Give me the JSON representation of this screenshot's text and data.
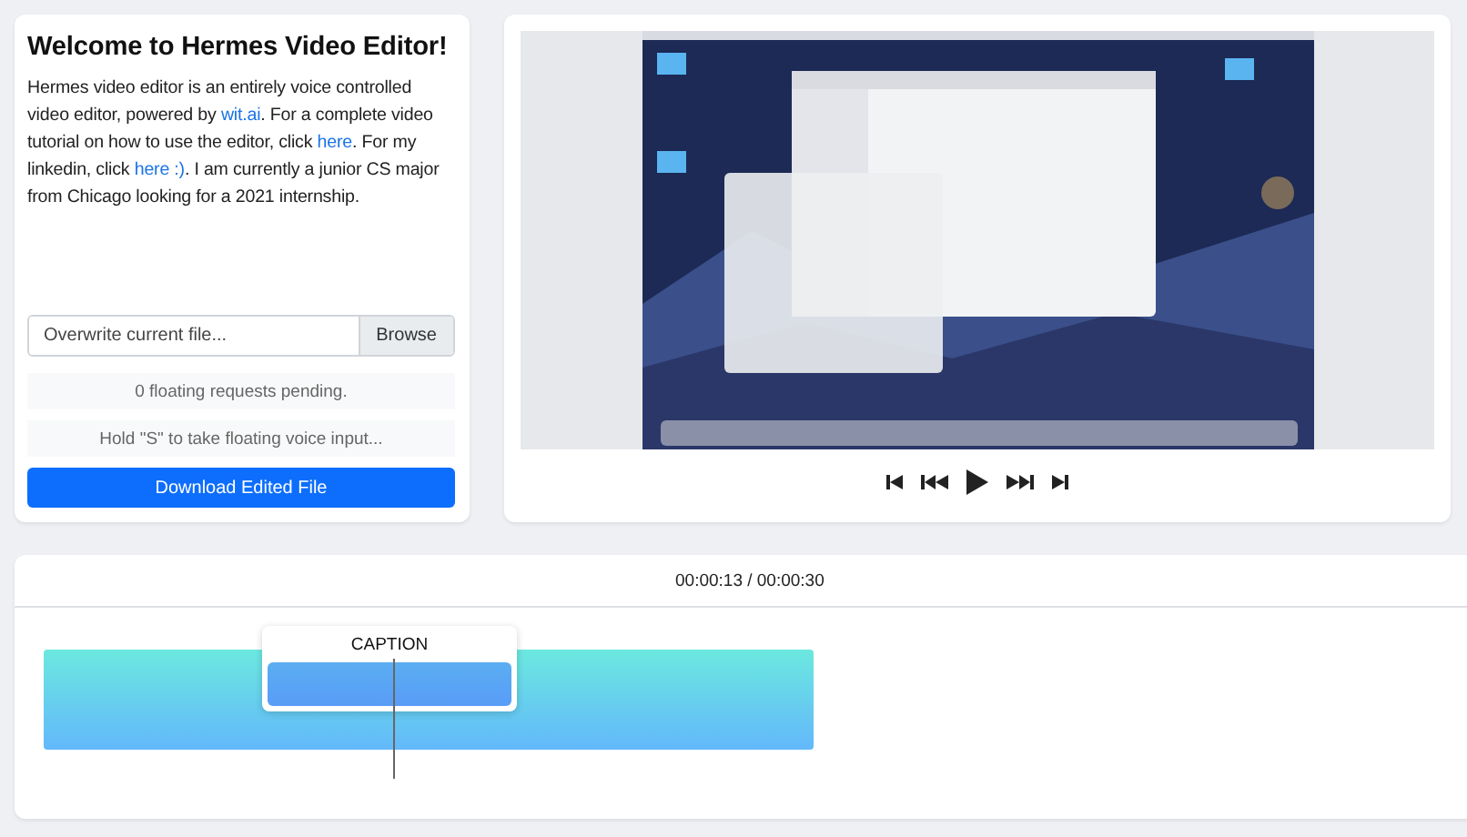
{
  "intro": {
    "title": "Welcome to Hermes Video Editor!",
    "paragraph": [
      {
        "kind": "text",
        "text": "Hermes video editor is an entirely voice controlled video editor, powered by "
      },
      {
        "kind": "link",
        "text": "wit.ai"
      },
      {
        "kind": "text",
        "text": ". For a complete video tutorial on how to use the editor, click "
      },
      {
        "kind": "link",
        "text": "here"
      },
      {
        "kind": "text",
        "text": ". For my linkedin, click "
      },
      {
        "kind": "link",
        "text": "here :)"
      },
      {
        "kind": "text",
        "text": ". I am currently a junior CS major from Chicago looking for a 2021 internship."
      }
    ]
  },
  "file_input": {
    "placeholder": "Overwrite current file...",
    "button": "Browse"
  },
  "status": [
    "0 floating requests pending.",
    "Hold \"S\" to take floating voice input..."
  ],
  "download_button": "Download Edited File",
  "timeline": {
    "time": "00:00:13 / 00:00:30",
    "caption": "CAPTION"
  }
}
